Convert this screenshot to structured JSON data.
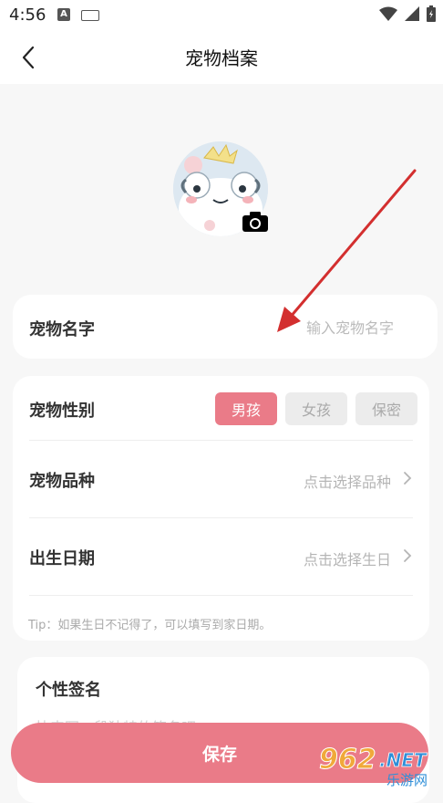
{
  "status_bar": {
    "time": "4:56",
    "a_icon": "A"
  },
  "header": {
    "title": "宠物档案"
  },
  "name_card": {
    "label": "宠物名字",
    "placeholder": "输入宠物名字",
    "value": ""
  },
  "info_card": {
    "gender_label": "宠物性别",
    "gender_options": [
      "男孩",
      "女孩",
      "保密"
    ],
    "gender_selected": "男孩",
    "breed_label": "宠物品种",
    "breed_value": "点击选择品种",
    "birthday_label": "出生日期",
    "birthday_value": "点击选择生日",
    "tip": "Tip：如果生日不记得了，可以填写到家日期。"
  },
  "signature_card": {
    "label": "个性签名",
    "placeholder": "快来写一段独特的签名吧"
  },
  "save_button": {
    "label": "保存"
  },
  "watermark": {
    "number": "962",
    "suffix": ".NET",
    "caption": "乐游网"
  },
  "colors": {
    "accent": "#ea7b88",
    "background": "#f7f7f7",
    "annotation_arrow": "#d32f2f"
  },
  "icons": {
    "back": "chevron-left-icon",
    "camera": "camera-icon",
    "row_chevron": "chevron-right-icon"
  }
}
